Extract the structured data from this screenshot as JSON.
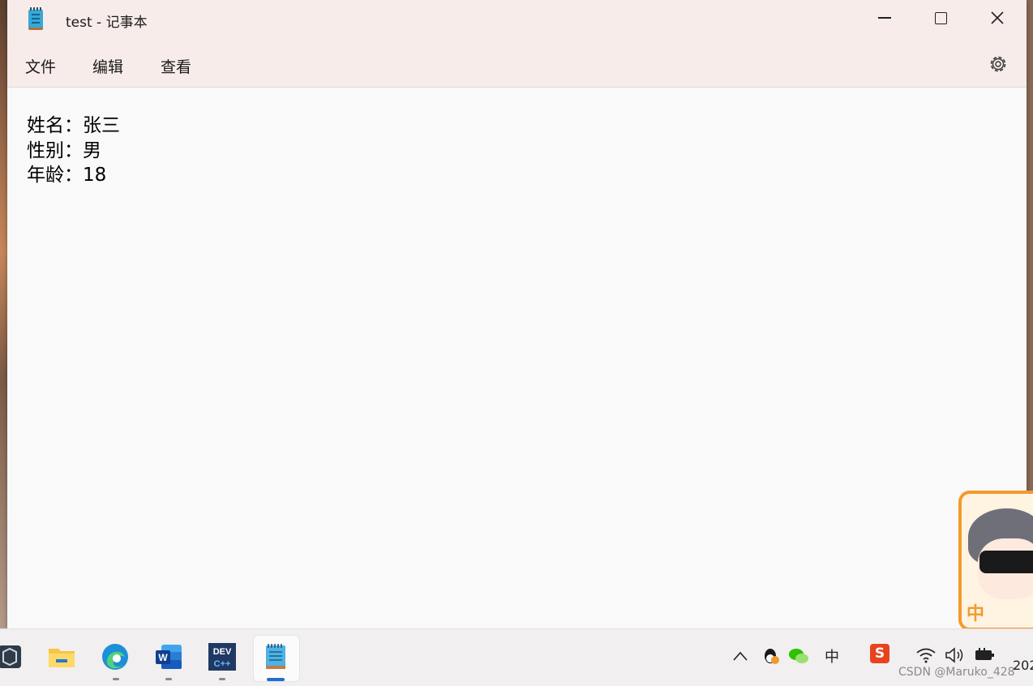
{
  "window": {
    "title": "test - 记事本"
  },
  "menu": {
    "file": "文件",
    "edit": "编辑",
    "view": "查看"
  },
  "editor": {
    "lines": [
      "姓名：张三",
      "性别：男",
      "年龄：18"
    ]
  },
  "sticker": {
    "char": "中"
  },
  "taskbar": {
    "apps": [
      "vmware-icon",
      "file-explorer-icon",
      "edge-icon",
      "word-icon",
      "dev-cpp-icon",
      "notepad-icon"
    ],
    "dev_label_top": "DEV",
    "dev_label_bottom": "C++",
    "word_letter": "W",
    "tray_ime": "中",
    "tray_sogou": "S",
    "clock_partial": "202",
    "watermark": "CSDN @Maruko_428"
  },
  "colors": {
    "titlebar": "#f7ecea",
    "editor_bg": "#f9f9f9",
    "accent": "#1f6fd1",
    "sticker_border": "#f39a2c"
  }
}
